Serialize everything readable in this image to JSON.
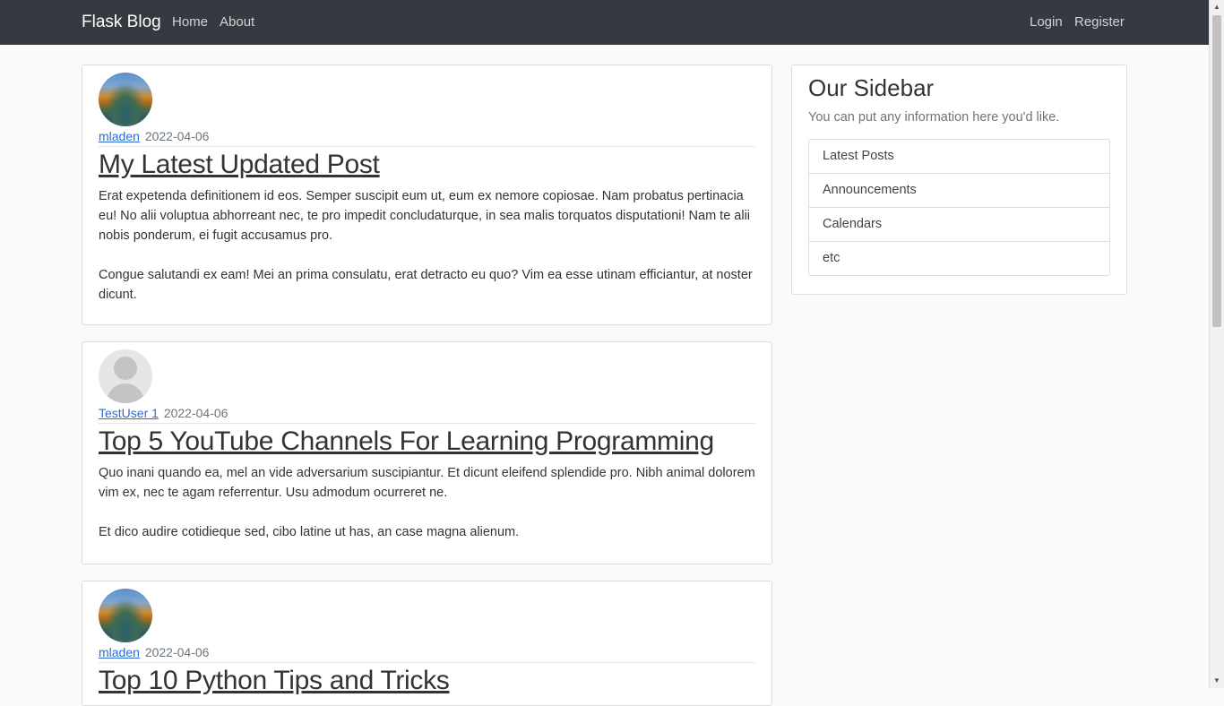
{
  "navbar": {
    "brand": "Flask Blog",
    "left_links": [
      "Home",
      "About"
    ],
    "right_links": [
      "Login",
      "Register"
    ]
  },
  "posts": [
    {
      "author": "mladen",
      "date": "2022-04-06",
      "title": "My Latest Updated Post",
      "content": "Erat expetenda definitionem id eos. Semper suscipit eum ut, eum ex nemore copiosae. Nam probatus pertinacia eu! No alii voluptua abhorreant nec, te pro impedit concludaturque, in sea malis torquatos disputationi! Nam te alii nobis ponderum, ei fugit accusamus pro.\n\nCongue salutandi ex eam! Mei an prima consulatu, erat detracto eu quo? Vim ea esse utinam efficiantur, at noster dicunt.",
      "avatar": "landscape-photo"
    },
    {
      "author": "TestUser 1",
      "date": "2022-04-06",
      "title": "Top 5 YouTube Channels For Learning Programming",
      "content": "Quo inani quando ea, mel an vide adversarium suscipiantur. Et dicunt eleifend splendide pro. Nibh animal dolorem vim ex, nec te agam referrentur. Usu admodum ocurreret ne.\n\nEt dico audire cotidieque sed, cibo latine ut has, an case magna alienum.",
      "avatar": "default-user"
    },
    {
      "author": "mladen",
      "date": "2022-04-06",
      "title": "Top 10 Python Tips and Tricks",
      "content": "",
      "avatar": "landscape-photo"
    }
  ],
  "sidebar": {
    "title": "Our Sidebar",
    "description": "You can put any information here you'd like.",
    "items": [
      "Latest Posts",
      "Announcements",
      "Calendars",
      "etc"
    ]
  },
  "colors": {
    "navbar_bg": "#343a40",
    "author_link": "#2a6cd6",
    "page_bg": "#fafafa"
  }
}
